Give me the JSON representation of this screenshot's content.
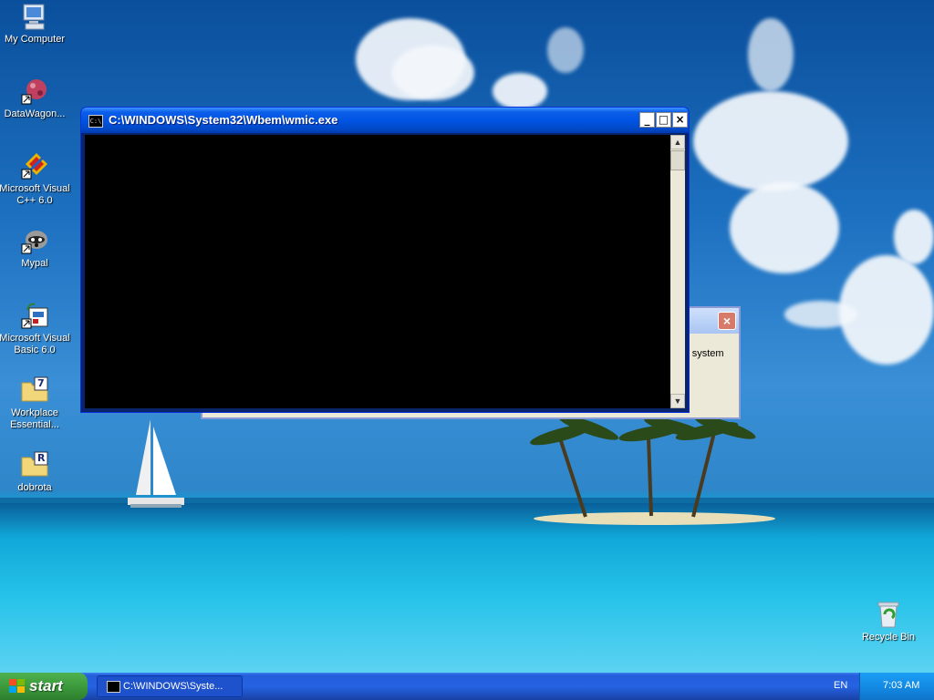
{
  "desktop": {
    "icons": [
      {
        "label": "My Computer"
      },
      {
        "label": "DataWagon..."
      },
      {
        "label": "Microsoft Visual C++ 6.0"
      },
      {
        "label": "Mypal"
      },
      {
        "label": "Microsoft Visual Basic 6.0"
      },
      {
        "label": "Workplace Essential..."
      },
      {
        "label": "dobrota"
      },
      {
        "label": "Recycle Bin"
      }
    ],
    "folder_badges": {
      "workplace": "7",
      "dobrota": "R"
    }
  },
  "cmd_window": {
    "title": "C:\\WINDOWS\\System32\\Wbem\\wmic.exe",
    "icon_text": "C:\\",
    "buttons": {
      "minimize": "_",
      "maximize": "□",
      "close": "×"
    },
    "scroll": {
      "up": "▲",
      "down": "▼"
    }
  },
  "background_dialog": {
    "visible_text": "r system",
    "close": "×"
  },
  "taskbar": {
    "start_label": "start",
    "task_label": "C:\\WINDOWS\\Syste...",
    "language": "EN",
    "clock": "7:03 AM"
  }
}
